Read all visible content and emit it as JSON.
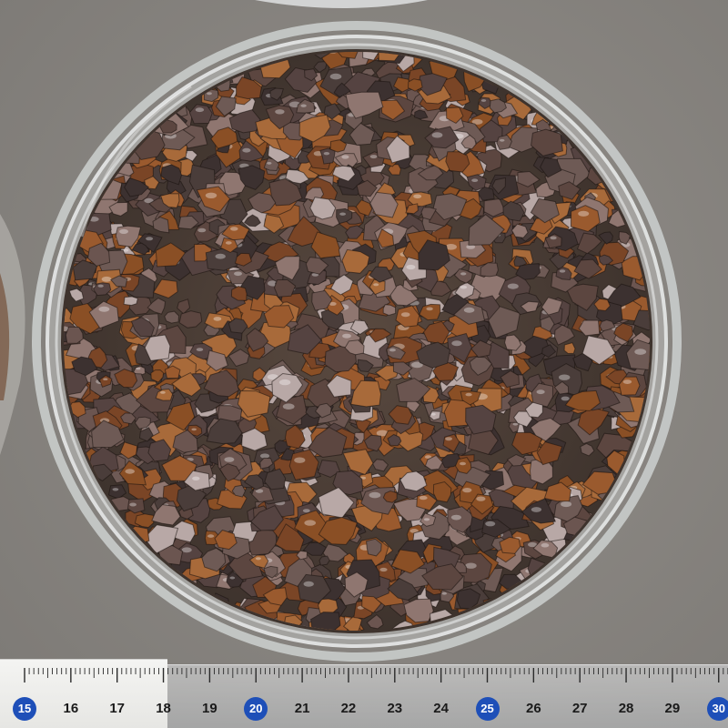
{
  "ruler": {
    "unit": "cm",
    "labels": [
      "15",
      "16",
      "17",
      "18",
      "19",
      "20",
      "21",
      "22",
      "23",
      "24",
      "25",
      "26",
      "27",
      "28",
      "29",
      "30"
    ],
    "highlighted": [
      "15",
      "20",
      "25",
      "30"
    ]
  },
  "colors": {
    "background": "#8a8884",
    "dish_glass": "#d8dcdc",
    "stone_amber": "#8a4f25",
    "stone_smoky": "#4a3d3a",
    "ruler_badge": "#1e4fb8"
  }
}
